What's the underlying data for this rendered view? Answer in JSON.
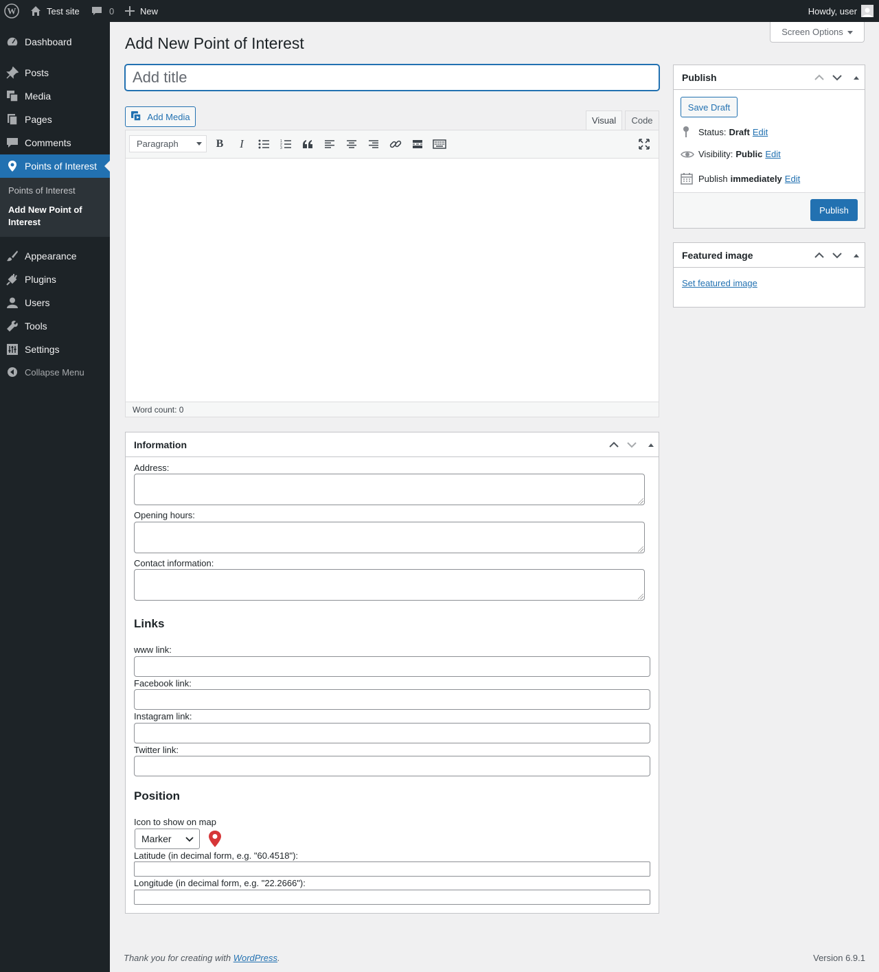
{
  "adminbar": {
    "site_name": "Test site",
    "comments_count": "0",
    "new_label": "New",
    "howdy": "Howdy, user"
  },
  "sidebar": {
    "items": [
      {
        "label": "Dashboard",
        "icon": "dashboard-icon"
      },
      {
        "label": "Posts",
        "icon": "pin-icon"
      },
      {
        "label": "Media",
        "icon": "media-icon"
      },
      {
        "label": "Pages",
        "icon": "pages-icon"
      },
      {
        "label": "Comments",
        "icon": "comment-icon"
      },
      {
        "label": "Points of Interest",
        "icon": "location-icon"
      },
      {
        "label": "Appearance",
        "icon": "brush-icon"
      },
      {
        "label": "Plugins",
        "icon": "plug-icon"
      },
      {
        "label": "Users",
        "icon": "user-icon"
      },
      {
        "label": "Tools",
        "icon": "wrench-icon"
      },
      {
        "label": "Settings",
        "icon": "sliders-icon"
      }
    ],
    "submenu": [
      "Points of Interest",
      "Add New Point of Interest"
    ],
    "collapse_label": "Collapse Menu"
  },
  "header": {
    "screen_options": "Screen Options",
    "page_title": "Add New Point of Interest"
  },
  "editor": {
    "title_placeholder": "Add title",
    "add_media": "Add Media",
    "tab_visual": "Visual",
    "tab_code": "Code",
    "format": "Paragraph",
    "word_count": "Word count: 0"
  },
  "publish": {
    "title": "Publish",
    "save_draft": "Save Draft",
    "status_label": "Status:",
    "status_value": "Draft",
    "visibility_label": "Visibility:",
    "visibility_value": "Public",
    "publish_label": "Publish",
    "publish_value": "immediately",
    "edit": "Edit",
    "publish_button": "Publish"
  },
  "featured_image": {
    "title": "Featured image",
    "set_link": "Set featured image"
  },
  "information": {
    "title": "Information",
    "address_label": "Address:",
    "hours_label": "Opening hours:",
    "contact_label": "Contact information:",
    "links_heading": "Links",
    "www_label": "www link:",
    "facebook_label": "Facebook link:",
    "instagram_label": "Instagram link:",
    "twitter_label": "Twitter link:",
    "position_heading": "Position",
    "icon_label": "Icon to show on map",
    "icon_value": "Marker",
    "latitude_label": "Latitude (in decimal form, e.g. \"60.4518\"):",
    "longitude_label": "Longitude (in decimal form, e.g. \"22.2666\"):"
  },
  "footer": {
    "thanks_prefix": "Thank you for creating with ",
    "thanks_link": "WordPress",
    "thanks_suffix": ".",
    "version": "Version 6.9.1"
  },
  "colors": {
    "accent": "#2271b1",
    "adminbar": "#1d2327",
    "marker": "#d63638"
  }
}
